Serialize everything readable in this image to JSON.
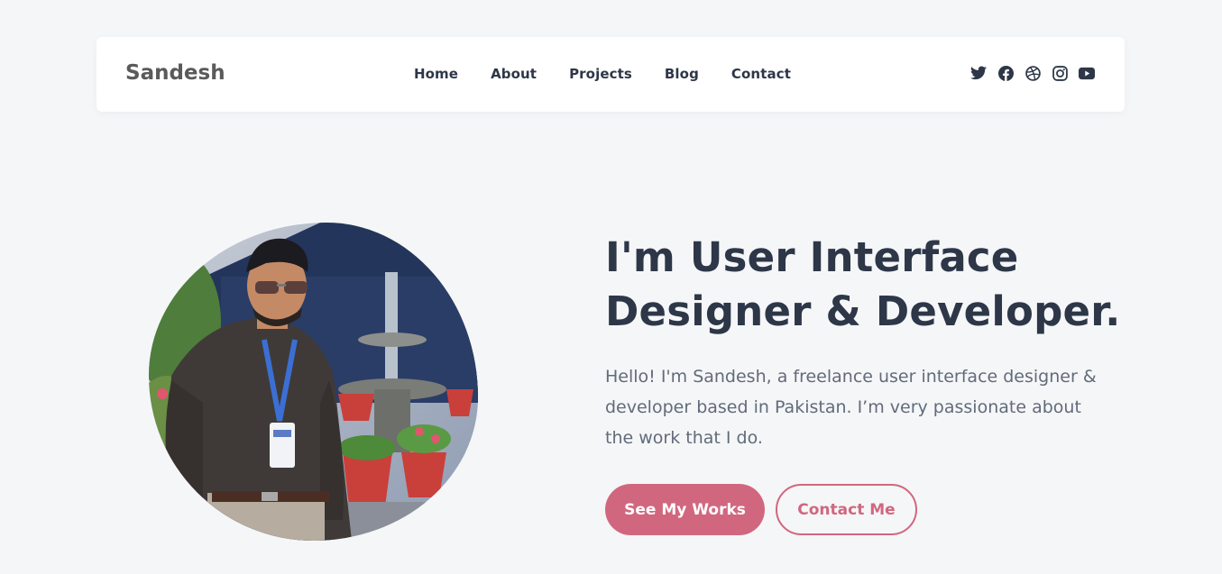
{
  "header": {
    "brand": "Sandesh",
    "nav": [
      {
        "label": "Home"
      },
      {
        "label": "About"
      },
      {
        "label": "Projects"
      },
      {
        "label": "Blog"
      },
      {
        "label": "Contact"
      }
    ],
    "socials": [
      {
        "icon": "twitter-icon"
      },
      {
        "icon": "facebook-icon"
      },
      {
        "icon": "dribbble-icon"
      },
      {
        "icon": "instagram-icon"
      },
      {
        "icon": "youtube-icon"
      }
    ]
  },
  "hero": {
    "headline_line1": "I'm User Interface",
    "headline_line2": "Designer & Developer.",
    "intro": "Hello! I'm Sandesh, a freelance user interface designer & developer based in Pakistan. I’m very passionate about the work that I do.",
    "primary_button": "See My Works",
    "secondary_button": "Contact Me"
  },
  "colors": {
    "background": "#f5f6f8",
    "text_dark": "#2d3748",
    "text_muted": "#626b7a",
    "accent": "#d1677e"
  }
}
